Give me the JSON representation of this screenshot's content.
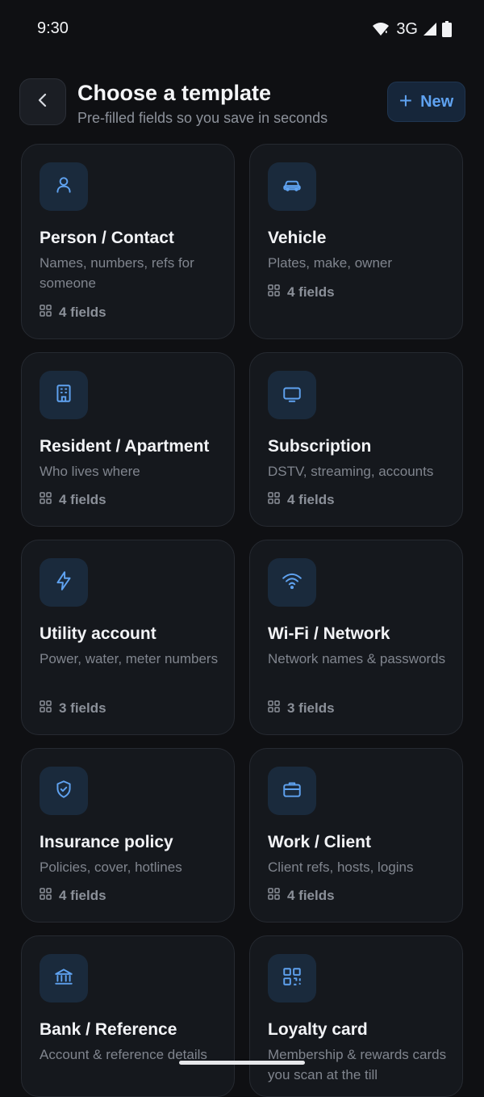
{
  "status_bar": {
    "time": "9:30",
    "network": "3G"
  },
  "header": {
    "title": "Choose a template",
    "subtitle": "Pre-filled fields so you save in seconds",
    "new_label": "New"
  },
  "colors": {
    "accent": "#5fa2f0",
    "card_bg": "#15181d",
    "icon_bg": "#1a2a3c"
  },
  "templates": [
    {
      "icon": "person-icon",
      "title": "Person / Contact",
      "description": "Names, numbers, refs for someone",
      "fields": "4 fields"
    },
    {
      "icon": "car-icon",
      "title": "Vehicle",
      "description": "Plates, make, owner",
      "fields": "4 fields"
    },
    {
      "icon": "building-icon",
      "title": "Resident / Apartment",
      "description": "Who lives where",
      "fields": "4 fields"
    },
    {
      "icon": "tv-icon",
      "title": "Subscription",
      "description": "DSTV, streaming, accounts",
      "fields": "4 fields"
    },
    {
      "icon": "lightning-icon",
      "title": "Utility account",
      "description": "Power, water, meter numbers",
      "fields": "3 fields"
    },
    {
      "icon": "wifi-icon",
      "title": "Wi-Fi / Network",
      "description": "Network names & passwords",
      "fields": "3 fields"
    },
    {
      "icon": "shield-check-icon",
      "title": "Insurance policy",
      "description": "Policies, cover, hotlines",
      "fields": "4 fields"
    },
    {
      "icon": "briefcase-icon",
      "title": "Work / Client",
      "description": "Client refs, hosts, logins",
      "fields": "4 fields"
    },
    {
      "icon": "bank-icon",
      "title": "Bank / Reference",
      "description": "Account & reference details",
      "fields": ""
    },
    {
      "icon": "qr-code-icon",
      "title": "Loyalty card",
      "description": "Membership & rewards cards you scan at the till",
      "fields": ""
    }
  ]
}
